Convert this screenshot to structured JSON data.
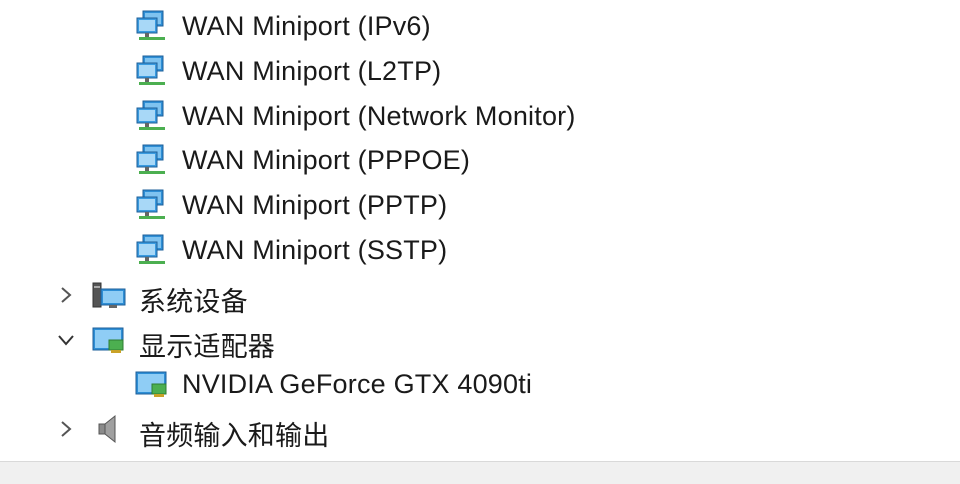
{
  "tree": {
    "network_children": [
      {
        "label": "WAN Miniport (IPv6)"
      },
      {
        "label": "WAN Miniport (L2TP)"
      },
      {
        "label": "WAN Miniport (Network Monitor)"
      },
      {
        "label": "WAN Miniport (PPPOE)"
      },
      {
        "label": "WAN Miniport (PPTP)"
      },
      {
        "label": "WAN Miniport (SSTP)"
      }
    ],
    "system_devices": {
      "label": "系统设备",
      "expanded": false,
      "icon": "system-devices-icon"
    },
    "display_adapters": {
      "label": "显示适配器",
      "expanded": true,
      "icon": "display-adapter-icon"
    },
    "display_children": [
      {
        "label": "NVIDIA GeForce GTX 4090ti",
        "icon": "display-adapter-icon"
      }
    ],
    "audio": {
      "label": "音频输入和输出",
      "expanded": false,
      "icon": "speaker-icon"
    }
  }
}
